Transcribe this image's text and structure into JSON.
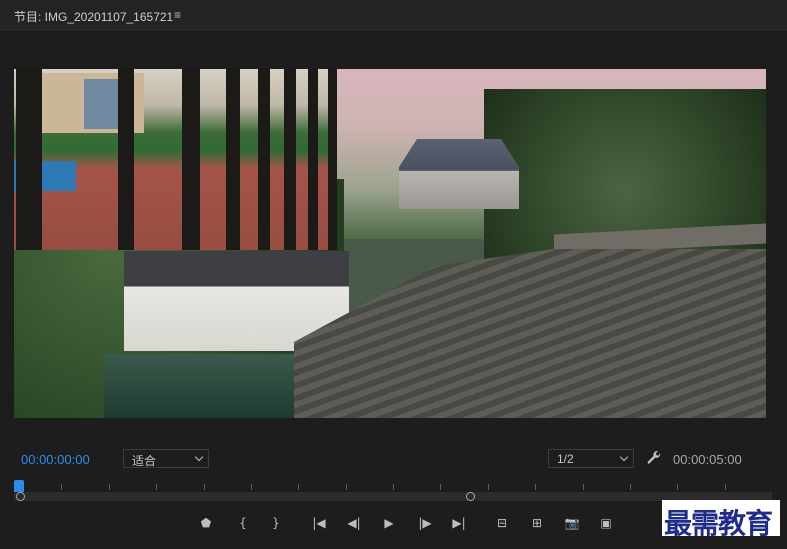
{
  "panel": {
    "title": "节目: IMG_20201107_165721",
    "menu_glyph": "≡"
  },
  "viewer": {
    "current_timecode": "00:00:00:00",
    "zoom": {
      "selected": "适合"
    },
    "resolution": {
      "selected": "1/2"
    },
    "duration_timecode": "00:00:05:00"
  },
  "timeline": {
    "playhead_fraction": 0.0,
    "in_point_fraction": 0.0,
    "out_point_fraction": 0.6
  },
  "transport": {
    "buttons": [
      {
        "name": "add-marker-button",
        "glyph": "⬟"
      },
      {
        "name": "mark-in-button",
        "glyph": "{"
      },
      {
        "name": "mark-out-button",
        "glyph": "}"
      },
      {
        "name": "go-to-in-button",
        "glyph": "|◀"
      },
      {
        "name": "step-back-button",
        "glyph": "◀|"
      },
      {
        "name": "play-button",
        "glyph": "▶"
      },
      {
        "name": "step-forward-button",
        "glyph": "|▶"
      },
      {
        "name": "go-to-out-button",
        "glyph": "▶|"
      },
      {
        "name": "lift-button",
        "glyph": "⊟"
      },
      {
        "name": "extract-button",
        "glyph": "⊞"
      },
      {
        "name": "export-frame-button",
        "glyph": "📷"
      },
      {
        "name": "comparison-view-button",
        "glyph": "▣"
      }
    ]
  },
  "watermark": {
    "text": "最需教育"
  },
  "colors": {
    "accent": "#2d8ceb",
    "panel_bg": "#1d1d1d"
  }
}
